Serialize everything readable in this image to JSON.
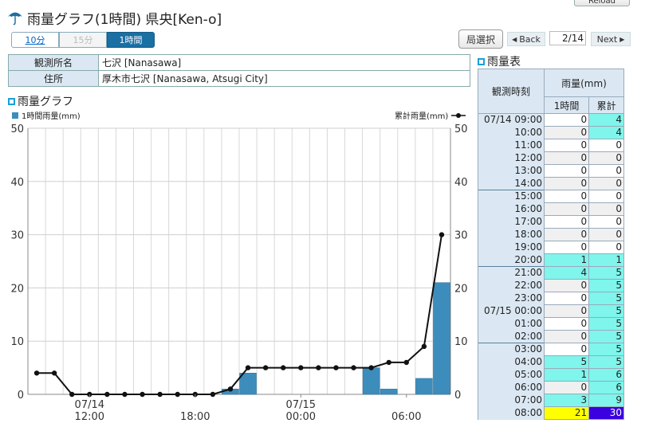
{
  "header": {
    "title": "雨量グラフ(1時間) 県央[Ken-o]",
    "reload_label": "Reload"
  },
  "interval_tabs": [
    "10分",
    "15分",
    "1時間"
  ],
  "nav": {
    "select_station": "局選択",
    "back": "Back",
    "page": "2/14",
    "next": "Next"
  },
  "station": {
    "name_label": "観測所名",
    "name_value": "七沢 [Nanasawa]",
    "address_label": "住所",
    "address_value": "厚木市七沢 [Nanasawa, Atsugi City]"
  },
  "graph": {
    "section_title": "雨量グラフ",
    "legend_hourly": "1時間雨量(mm)",
    "legend_cumulative": "累計雨量(mm)"
  },
  "chart_data": {
    "type": "bar",
    "x": [
      "07/14 09:00",
      "07/14 10:00",
      "07/14 11:00",
      "07/14 12:00",
      "07/14 13:00",
      "07/14 14:00",
      "07/14 15:00",
      "07/14 16:00",
      "07/14 17:00",
      "07/14 18:00",
      "07/14 19:00",
      "07/14 20:00",
      "07/14 21:00",
      "07/14 22:00",
      "07/14 23:00",
      "07/15 00:00",
      "07/15 01:00",
      "07/15 02:00",
      "07/15 03:00",
      "07/15 04:00",
      "07/15 05:00",
      "07/15 06:00",
      "07/15 07:00",
      "07/15 08:00"
    ],
    "series": [
      {
        "name": "1時間雨量(mm)",
        "type": "bar",
        "values": [
          0,
          0,
          0,
          0,
          0,
          0,
          0,
          0,
          0,
          0,
          0,
          1,
          4,
          0,
          0,
          0,
          0,
          0,
          0,
          5,
          1,
          0,
          3,
          21
        ]
      },
      {
        "name": "累計雨量(mm)",
        "type": "line",
        "values": [
          4,
          4,
          0,
          0,
          0,
          0,
          0,
          0,
          0,
          0,
          0,
          1,
          5,
          5,
          5,
          5,
          5,
          5,
          5,
          5,
          6,
          6,
          9,
          30
        ]
      }
    ],
    "x_tick_labels": [
      {
        "top": "07/14",
        "bottom": "12:00",
        "index": 3
      },
      {
        "top": "",
        "bottom": "18:00",
        "index": 9
      },
      {
        "top": "07/15",
        "bottom": "00:00",
        "index": 15
      },
      {
        "top": "",
        "bottom": "06:00",
        "index": 21
      }
    ],
    "ylim": [
      0,
      50
    ],
    "y_ticks": [
      0,
      10,
      20,
      30,
      40,
      50
    ],
    "grid": true,
    "bar_color": "#3c8dbc",
    "line_color": "#111111"
  },
  "rain_table": {
    "title": "雨量表",
    "col_time": "観測時刻",
    "col_rain": "雨量(mm)",
    "col_hourly": "1時間",
    "col_total": "累計",
    "rows": [
      {
        "time": "07/14 09:00",
        "hourly": "0",
        "total": "4"
      },
      {
        "time": "10:00",
        "hourly": "0",
        "total": "4"
      },
      {
        "time": "11:00",
        "hourly": "0",
        "total": "0"
      },
      {
        "time": "12:00",
        "hourly": "0",
        "total": "0"
      },
      {
        "time": "13:00",
        "hourly": "0",
        "total": "0"
      },
      {
        "time": "14:00",
        "hourly": "0",
        "total": "0"
      },
      {
        "time": "15:00",
        "hourly": "0",
        "total": "0"
      },
      {
        "time": "16:00",
        "hourly": "0",
        "total": "0"
      },
      {
        "time": "17:00",
        "hourly": "0",
        "total": "0"
      },
      {
        "time": "18:00",
        "hourly": "0",
        "total": "0"
      },
      {
        "time": "19:00",
        "hourly": "0",
        "total": "0"
      },
      {
        "time": "20:00",
        "hourly": "1",
        "total": "1"
      },
      {
        "time": "21:00",
        "hourly": "4",
        "total": "5"
      },
      {
        "time": "22:00",
        "hourly": "0",
        "total": "5"
      },
      {
        "time": "23:00",
        "hourly": "0",
        "total": "5"
      },
      {
        "time": "07/15 00:00",
        "hourly": "0",
        "total": "5"
      },
      {
        "time": "01:00",
        "hourly": "0",
        "total": "5"
      },
      {
        "time": "02:00",
        "hourly": "0",
        "total": "5"
      },
      {
        "time": "03:00",
        "hourly": "0",
        "total": "5"
      },
      {
        "time": "04:00",
        "hourly": "5",
        "total": "5"
      },
      {
        "time": "05:00",
        "hourly": "1",
        "total": "6"
      },
      {
        "time": "06:00",
        "hourly": "0",
        "total": "6"
      },
      {
        "time": "07:00",
        "hourly": "3",
        "total": "9"
      },
      {
        "time": "08:00",
        "hourly": "21",
        "total": "30"
      }
    ],
    "colors": {
      "light": "#7ff5ec",
      "medium_yellow": "#ffff00",
      "heavy_purple": "#3a00e0"
    }
  }
}
